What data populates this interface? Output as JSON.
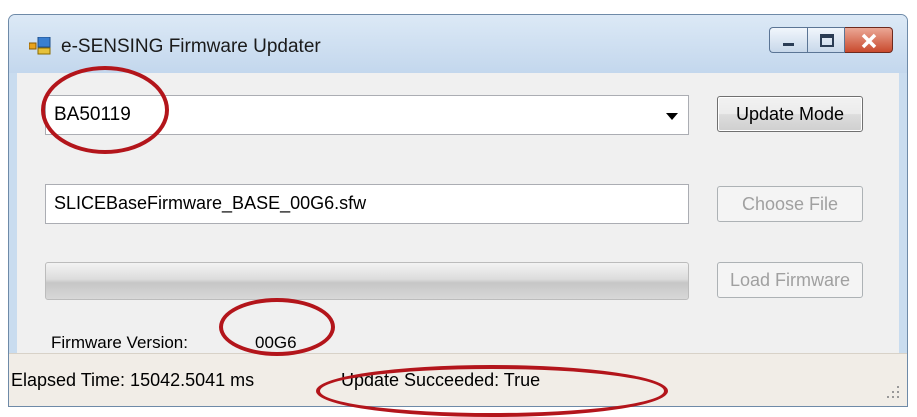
{
  "window": {
    "title": "e-SENSING Firmware Updater",
    "app_icon": "app-window-icon",
    "controls": [
      "minimize-icon",
      "maximize-icon",
      "close-icon"
    ]
  },
  "device_combo": {
    "selected": "BA50119",
    "arrow_icon": "chevron-down-icon"
  },
  "buttons": {
    "update_mode": "Update Mode",
    "choose_file": "Choose File",
    "load_firmware": "Load Firmware"
  },
  "file_input": {
    "value": "SLICEBaseFirmware_BASE_00G6.sfw"
  },
  "progress": {
    "fraction": 0.0
  },
  "firmware": {
    "label": "Firmware Version:",
    "value": "00G6"
  },
  "status": {
    "elapsed": "Elapsed Time: 15042.5041 ms",
    "succeeded": "Update Succeeded: True"
  },
  "colors": {
    "annotation_red": "#b3151b",
    "titlebar": "#c9dcef"
  }
}
